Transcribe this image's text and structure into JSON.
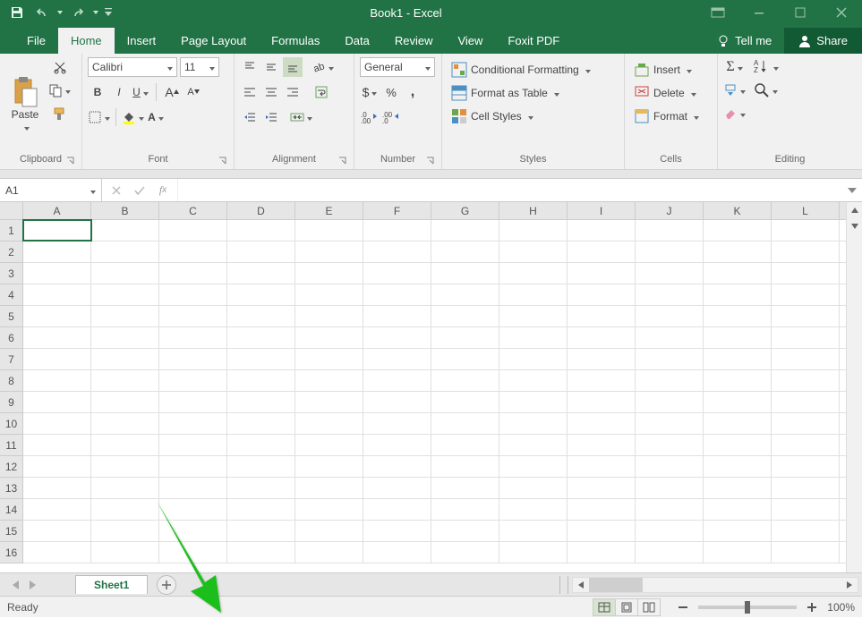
{
  "title": "Book1 - Excel",
  "tabs": {
    "file": "File",
    "home": "Home",
    "insert": "Insert",
    "pagelayout": "Page Layout",
    "formulas": "Formulas",
    "data": "Data",
    "review": "Review",
    "view": "View",
    "foxit": "Foxit PDF",
    "tellme": "Tell me",
    "share": "Share"
  },
  "ribbon": {
    "clipboard": {
      "label": "Clipboard",
      "paste": "Paste"
    },
    "font": {
      "label": "Font",
      "name": "Calibri",
      "size": "11",
      "bold": "B",
      "italic": "I",
      "underline": "U"
    },
    "alignment": {
      "label": "Alignment"
    },
    "number": {
      "label": "Number",
      "format": "General"
    },
    "styles": {
      "label": "Styles",
      "condfmt": "Conditional Formatting",
      "table": "Format as Table",
      "cellstyles": "Cell Styles"
    },
    "cells": {
      "label": "Cells",
      "insert": "Insert",
      "delete": "Delete",
      "format": "Format"
    },
    "editing": {
      "label": "Editing"
    }
  },
  "namebox": "A1",
  "columns": [
    "A",
    "B",
    "C",
    "D",
    "E",
    "F",
    "G",
    "H",
    "I",
    "J",
    "K",
    "L"
  ],
  "rows": [
    "1",
    "2",
    "3",
    "4",
    "5",
    "6",
    "7",
    "8",
    "9",
    "10",
    "11",
    "12",
    "13",
    "14",
    "15",
    "16"
  ],
  "sheet": {
    "name": "Sheet1"
  },
  "status": {
    "ready": "Ready",
    "zoom": "100%"
  }
}
